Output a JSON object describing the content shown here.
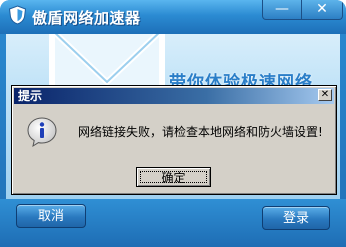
{
  "app": {
    "title": "傲盾网络加速器",
    "minimize_label": "—",
    "close_label": "✕",
    "slogan": "带你体验极速网络",
    "cancel_label": "取消",
    "login_label": "登录"
  },
  "dialog": {
    "title": "提示",
    "close_label": "✕",
    "message": "网络链接失败，请检查本地网络和防火墙设置!",
    "ok_label": "确定",
    "icon": "info-icon"
  },
  "colors": {
    "accent": "#2b8bd2",
    "dialog_title_bg": "#0a246a",
    "dialog_bg": "#d4d0c8"
  }
}
